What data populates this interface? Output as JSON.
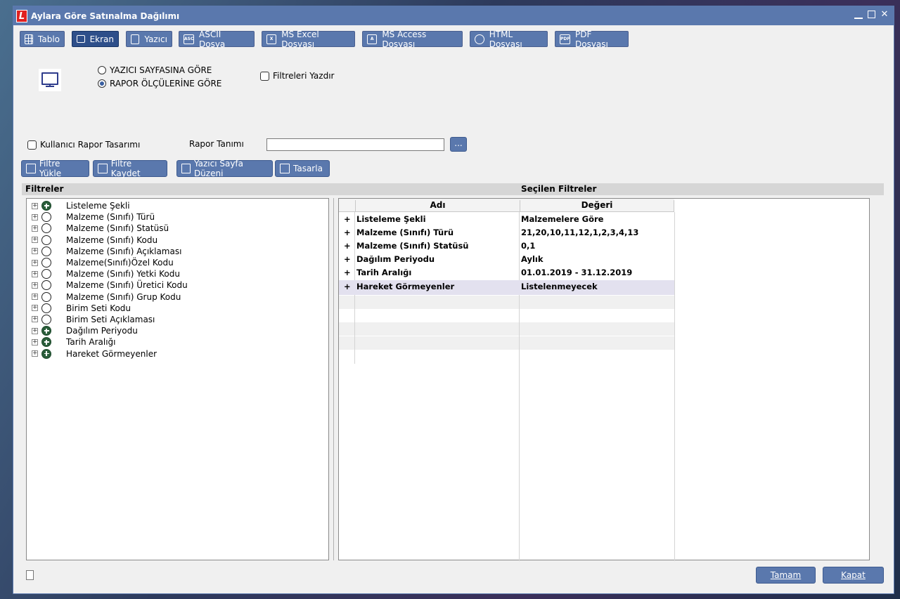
{
  "window": {
    "title": "Aylara Göre Satınalma Dağılımı",
    "logo": "L"
  },
  "tabs": [
    {
      "label": "Tablo",
      "icon": "table-icon"
    },
    {
      "label": "Ekran",
      "icon": "monitor-icon"
    },
    {
      "label": "Yazıcı",
      "icon": "printer-icon"
    },
    {
      "label": "ASCII Dosya",
      "icon": "ascii-file-icon"
    },
    {
      "label": "MS Excel Dosyası",
      "icon": "excel-file-icon"
    },
    {
      "label": "MS Access Dosyası",
      "icon": "access-file-icon"
    },
    {
      "label": "HTML Dosyası",
      "icon": "globe-icon"
    },
    {
      "label": "PDF Dosyası",
      "icon": "pdf-file-icon"
    }
  ],
  "active_tab": "Ekran",
  "options": {
    "radio_printer": "YAZICI SAYFASINA GÖRE",
    "radio_report": "RAPOR ÖLÇÜLERİNE GÖRE",
    "selected": "RAPOR ÖLÇÜLERİNE GÖRE",
    "print_filters": "Filtreleri Yazdır",
    "user_design": "Kullanıcı Rapor Tasarımı",
    "report_def_label": "Rapor Tanımı",
    "report_def_value": "",
    "browse_label": "..."
  },
  "actions": {
    "load_filter": "Filtre Yükle",
    "save_filter": "Filtre Kaydet",
    "page_setup": "Yazıcı Sayfa Düzeni",
    "design": "Tasarla"
  },
  "filters": {
    "heading": "Filtreler",
    "items": [
      {
        "label": "Listeleme Şekli",
        "set": true
      },
      {
        "label": "Malzeme (Sınıfı) Türü",
        "set": false
      },
      {
        "label": "Malzeme (Sınıfı) Statüsü",
        "set": false
      },
      {
        "label": "Malzeme (Sınıfı) Kodu",
        "set": false
      },
      {
        "label": "Malzeme (Sınıfı) Açıklaması",
        "set": false
      },
      {
        "label": "Malzeme(Sınıfı)Özel Kodu",
        "set": false
      },
      {
        "label": "Malzeme (Sınıfı) Yetki Kodu",
        "set": false
      },
      {
        "label": "Malzeme (Sınıfı) Üretici Kodu",
        "set": false
      },
      {
        "label": "Malzeme (Sınıfı) Grup Kodu",
        "set": false
      },
      {
        "label": "Birim Seti Kodu",
        "set": false
      },
      {
        "label": "Birim Seti Açıklaması",
        "set": false
      },
      {
        "label": "Dağılım Periyodu",
        "set": true
      },
      {
        "label": "Tarih Aralığı",
        "set": true
      },
      {
        "label": "Hareket Görmeyenler",
        "set": true
      }
    ]
  },
  "selected_filters": {
    "heading": "Seçilen Filtreler",
    "col_name": "Adı",
    "col_value": "Değeri",
    "rows": [
      {
        "name": "Listeleme Şekli",
        "value": "Malzemelere Göre"
      },
      {
        "name": "Malzeme (Sınıfı) Türü",
        "value": "21,20,10,11,12,1,2,3,4,13"
      },
      {
        "name": "Malzeme (Sınıfı) Statüsü",
        "value": "0,1"
      },
      {
        "name": "Dağılım Periyodu",
        "value": "Aylık"
      },
      {
        "name": "Tarih Aralığı",
        "value": "01.01.2019 - 31.12.2019"
      },
      {
        "name": "Hareket Görmeyenler",
        "value": "Listelenmeyecek"
      }
    ],
    "plus": "+"
  },
  "footer": {
    "ok": "Tamam",
    "close": "Kapat"
  },
  "colors": {
    "accent": "#5a78ad",
    "active_tab": "#2e4f8a",
    "set_filter": "#2a5d3a"
  }
}
